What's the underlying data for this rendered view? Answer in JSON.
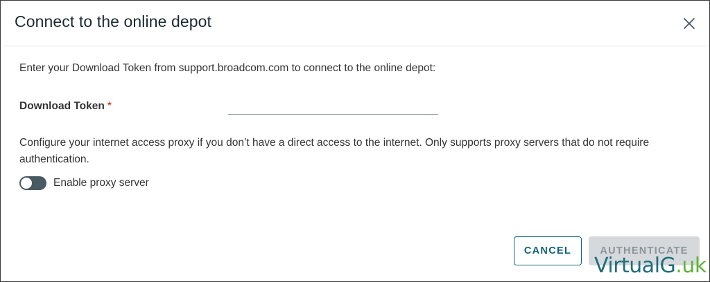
{
  "dialog": {
    "title": "Connect to the online depot",
    "intro": "Enter your Download Token from support.broadcom.com to connect to the online depot:",
    "token_field": {
      "label": "Download Token",
      "required_marker": "*",
      "value": "",
      "placeholder": ""
    },
    "proxy_description": "Configure your internet access proxy if you don’t have a direct access to the internet. Only supports proxy servers that do not require authentication.",
    "proxy_toggle": {
      "label": "Enable proxy server",
      "enabled": false
    },
    "buttons": {
      "cancel_label": "CANCEL",
      "authenticate_label": "AUTHENTICATE",
      "authenticate_disabled": true
    },
    "close_icon": "close-icon"
  },
  "watermark": {
    "text_main": "VirtualG",
    "text_accent": ".uk"
  },
  "colors": {
    "primary": "#0f6278",
    "required": "#c92100",
    "toggle_off": "#4a5a63",
    "disabled_button": "#d6d9db",
    "watermark_main": "#1f6e7c",
    "watermark_accent": "#5fb33a"
  }
}
